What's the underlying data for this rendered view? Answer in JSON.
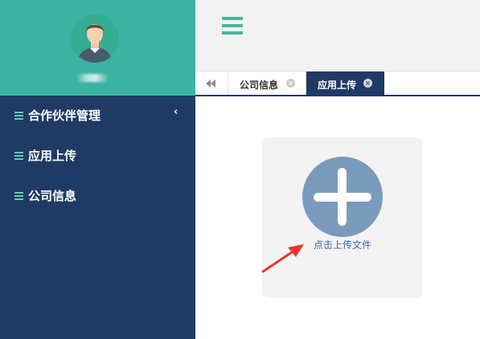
{
  "sidebar": {
    "items": [
      {
        "label": "合作伙伴管理"
      },
      {
        "label": "应用上传"
      },
      {
        "label": "公司信息"
      }
    ],
    "collapse_symbol": "‹"
  },
  "tabs": [
    {
      "label": "公司信息",
      "close_symbol": "×"
    },
    {
      "label": "应用上传",
      "close_symbol": "×",
      "active": true
    }
  ],
  "upload": {
    "label": "点击上传文件"
  },
  "icons": {
    "menu": "hamburger-icon",
    "back": "double-chevron-left-icon",
    "upload": "plus-icon",
    "arrow": "red-arrow-icon"
  },
  "colors": {
    "sidebar_header": "#3cb2a3",
    "sidebar": "#203a66",
    "accent": "#47b69c",
    "upload_circle": "#7b9bbd",
    "arrow": "#e8362c"
  }
}
